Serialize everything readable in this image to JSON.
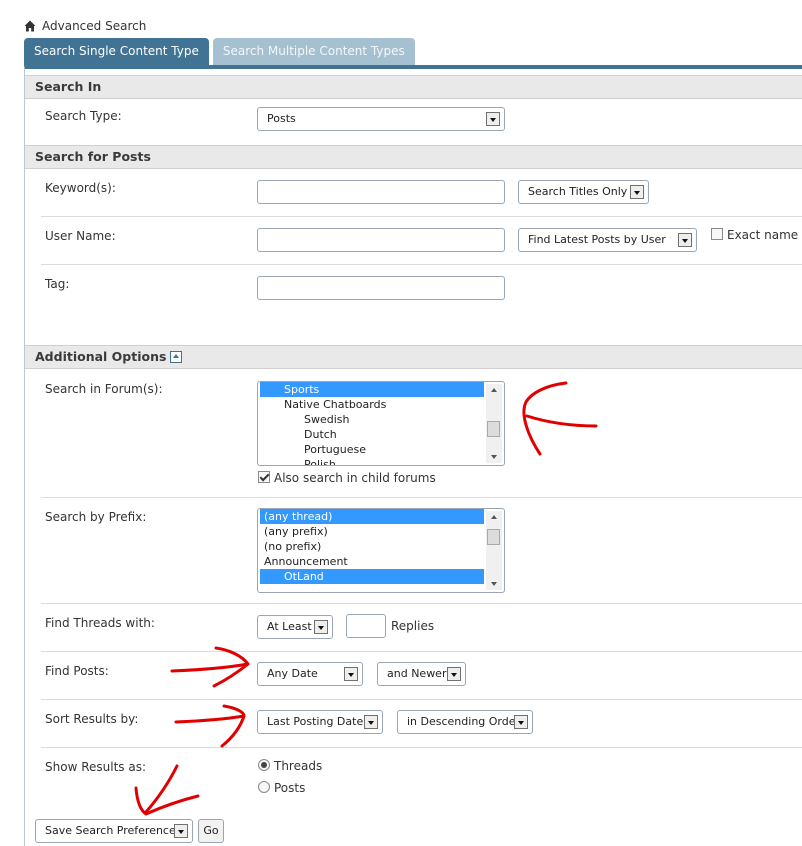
{
  "breadcrumb": {
    "label": "Advanced Search"
  },
  "tabs": [
    {
      "label": "Search Single Content Type",
      "active": true
    },
    {
      "label": "Search Multiple Content Types",
      "active": false
    }
  ],
  "sections": {
    "search_in": "Search In",
    "search_posts": "Search for Posts",
    "additional": "Additional Options"
  },
  "search_type": {
    "label": "Search Type:",
    "value": "Posts"
  },
  "keywords": {
    "label": "Keyword(s):",
    "value": "",
    "mode": "Search Titles Only"
  },
  "username": {
    "label": "User Name:",
    "value": "",
    "mode": "Find Latest Posts by User",
    "exact_label": "Exact name",
    "exact_checked": false
  },
  "tag": {
    "label": "Tag:",
    "value": ""
  },
  "forums": {
    "label": "Search in Forum(s):",
    "items": [
      {
        "text": "Sports",
        "indent": 1,
        "selected": true
      },
      {
        "text": "Native Chatboards",
        "indent": 1,
        "selected": false
      },
      {
        "text": "Swedish",
        "indent": 2,
        "selected": false
      },
      {
        "text": "Dutch",
        "indent": 2,
        "selected": false
      },
      {
        "text": "Portuguese",
        "indent": 2,
        "selected": false
      },
      {
        "text": "Polish",
        "indent": 2,
        "selected": false
      }
    ],
    "child_label": "Also search in child forums",
    "child_checked": true
  },
  "prefix": {
    "label": "Search by Prefix:",
    "items": [
      {
        "text": "(any thread)",
        "indent": 0,
        "selected": true
      },
      {
        "text": "(any prefix)",
        "indent": 0,
        "selected": false
      },
      {
        "text": "(no prefix)",
        "indent": 0,
        "selected": false
      },
      {
        "text": "Announcement",
        "indent": 0,
        "selected": false,
        "group": true
      },
      {
        "text": "OtLand",
        "indent": 1,
        "selected": true
      }
    ]
  },
  "threads_with": {
    "label": "Find Threads with:",
    "mode": "At Least",
    "value": "",
    "suffix": "Replies"
  },
  "find_posts": {
    "label": "Find Posts:",
    "date": "Any Date",
    "direction": "and Newer"
  },
  "sort": {
    "label": "Sort Results by:",
    "field": "Last Posting Date",
    "order": "in Descending Order"
  },
  "show_as": {
    "label": "Show Results as:",
    "options": [
      "Threads",
      "Posts"
    ],
    "selected": "Threads"
  },
  "prefs": {
    "value": "Save Search Preferences",
    "go_label": "Go"
  },
  "colors": {
    "accent": "#417394",
    "annotation": "#e00000",
    "selection": "#3399ff"
  }
}
